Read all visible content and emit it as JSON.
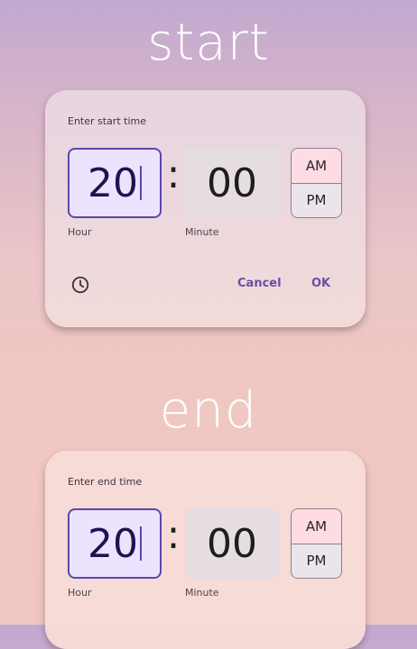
{
  "start": {
    "heading": "start",
    "dialog": {
      "title": "Enter start time",
      "hour": "20",
      "minute": "00",
      "separator": ":",
      "am_label": "AM",
      "pm_label": "PM",
      "selected_period": "AM",
      "hour_label": "Hour",
      "minute_label": "Minute",
      "cancel_label": "Cancel",
      "ok_label": "OK",
      "mode_icon": "clock-icon"
    }
  },
  "end": {
    "heading": "end",
    "dialog": {
      "title": "Enter end time",
      "hour": "20",
      "minute": "00",
      "separator": ":",
      "am_label": "AM",
      "pm_label": "PM",
      "selected_period": "AM",
      "hour_label": "Hour",
      "minute_label": "Minute"
    }
  },
  "colors": {
    "accent": "#6750a4",
    "hour_field_bg": "#ece3ff",
    "minute_field_bg": "#e5dde2",
    "am_selected_bg": "#ffdbe3"
  }
}
